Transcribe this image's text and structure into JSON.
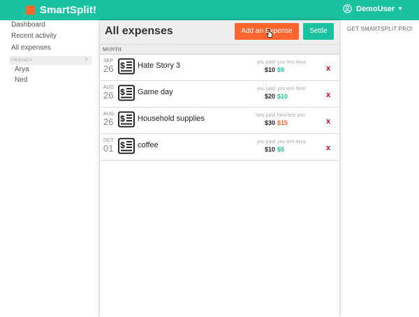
{
  "header": {
    "brand": "SmartSplit!",
    "user": "DemoUser",
    "colors": {
      "accent": "#1cc29f",
      "orange": "#ff652f"
    }
  },
  "sidebar": {
    "items": [
      {
        "label": "Dashboard"
      },
      {
        "label": "Recent activity"
      },
      {
        "label": "All expenses"
      }
    ],
    "friends_header": "FRIENDS",
    "friends": [
      {
        "name": "Arya"
      },
      {
        "name": "Ned"
      }
    ]
  },
  "main": {
    "title": "All expenses",
    "add_button": "Add an Expense",
    "settle_button": "Settle",
    "month_label": "MONTH",
    "expenses": [
      {
        "month": "SEP",
        "day": "26",
        "name": "Hate Story 3",
        "paid_label": "you paid",
        "paid_amount": "$10",
        "lent_label": "you lent Arya",
        "lent_amount": "$5",
        "lent_color": "#1cc29f",
        "delete": "x"
      },
      {
        "month": "AUG",
        "day": "26",
        "name": "Game day",
        "paid_label": "you paid",
        "paid_amount": "$20",
        "lent_label": "you lent Ned",
        "lent_amount": "$10",
        "lent_color": "#1cc29f",
        "delete": "x"
      },
      {
        "month": "AUG",
        "day": "26",
        "name": "Household supplies",
        "paid_label": "Ned paid",
        "paid_amount": "$30",
        "lent_label": "Ned lent you",
        "lent_amount": "$15",
        "lent_color": "#ff652f",
        "delete": "x"
      },
      {
        "month": "OCT",
        "day": "01",
        "name": "coffee",
        "paid_label": "you paid",
        "paid_amount": "$10",
        "lent_label": "you lent Arya",
        "lent_amount": "$5",
        "lent_color": "#1cc29f",
        "delete": "x"
      }
    ]
  },
  "right": {
    "promo": "GET SMARTSPLIT PRO!"
  },
  "icons": [
    "logo-icon",
    "user-icon",
    "chevron-down-icon",
    "receipt-icon",
    "cursor-icon"
  ]
}
